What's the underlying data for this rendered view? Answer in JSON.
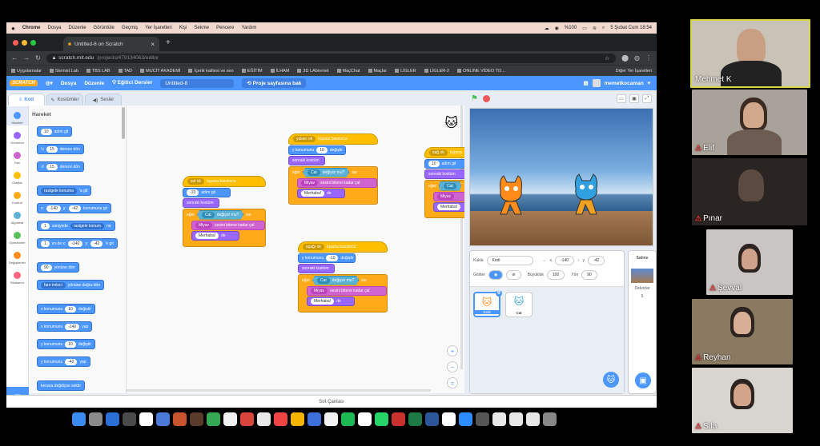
{
  "mac_menu": [
    "Chrome",
    "Dosya",
    "Düzenle",
    "Görüntüle",
    "Geçmiş",
    "Yer İşaretleri",
    "Kişi",
    "Sekme",
    "Pencere",
    "Yardım"
  ],
  "mac_status": {
    "battery": "%100",
    "date_time": "5 Şubat Cum  18:54"
  },
  "browser": {
    "tab_title": "Untitled-8 on Scratch",
    "url_host": "scratch.mit.edu",
    "url_path": "/projects/479134063/editor",
    "bookmarks": [
      "Uygulamalar",
      "Stemist Lab",
      "TBS LAB",
      "TAD",
      "MUCİT AKADEMİ",
      "İçerik kalitesi ve seo",
      "EĞİTİM",
      "İLHAM",
      "3D LAbirenet",
      "MaçChat",
      "Maçlar",
      "LİGLER",
      "LİGLER-2",
      "ONLINE VİDEO TO..."
    ],
    "other_bookmarks": "Diğer Yer İşaretleri"
  },
  "scratch_menu": {
    "logo": "SCRATCH",
    "file": "Dosya",
    "edit": "Düzenle",
    "tutorials": "Eğitici Dersler",
    "project_title": "Untitled-8",
    "share": "Proje sayfasına bak",
    "username": "memetkocaman"
  },
  "editor_tabs": {
    "code": "Kod",
    "costumes": "Kostümler",
    "sounds": "Sesler"
  },
  "categories": [
    "Hareket",
    "Görünüm",
    "Ses",
    "Olaylar",
    "Kontrol",
    "Algılama",
    "Operatörler",
    "Değişkenler",
    "Bloklarım"
  ],
  "palette": {
    "title": "Hareket",
    "move": "adım git",
    "move_val": "10",
    "turn_right": "derece dön",
    "turn_right_val": "15",
    "turn_left": "derece dön",
    "turn_left_val": "15",
    "goto": "rastgele konuma",
    "goto_suffix": "'a git",
    "goto_xy_x": "x:",
    "goto_xy_xv": "-140",
    "goto_xy_y": "y:",
    "goto_xy_yv": "-42",
    "goto_xy_suffix": "konumuna git",
    "glide": "saniyede",
    "glide_val": "1",
    "glide_dd": "rastgele konum",
    "glide_suffix": "na",
    "glide_xy": "sn.de x:",
    "glide_xy_val": "1",
    "glide_xy_x": "-140",
    "glide_xy_y": "y:",
    "glide_xy_yv": "-42",
    "glide_xy_suffix": "'e git",
    "point_dir": "yönüne dön",
    "point_dir_val": "90",
    "point_towards": "fare imleci",
    "point_towards_suffix": "yönüne doğru dön",
    "change_x": "x konumunu",
    "change_x_val": "10",
    "change_x_suffix": "değiştir",
    "set_x": "x konumunu",
    "set_x_val": "-140",
    "set_x_suffix": "yap",
    "change_y": "y konumunu",
    "change_y_val": "10",
    "change_y_suffix": "değiştir",
    "set_y": "y konumunu",
    "set_y_val": "-42",
    "set_y_suffix": "yap",
    "bounce": "kenara değdiyse sektir"
  },
  "scripts": {
    "left": {
      "key": "sol ok",
      "hat": "tuşuna basılınca",
      "move_val": "-10",
      "move": "adım git",
      "next": "sonraki kostüm",
      "if": "eğer",
      "sprite": "Cat",
      "touching": "değiyor mu?",
      "ise": "ise",
      "say": "Miyav",
      "sound": "sesini bitene kadar çal",
      "speak": "Merhaba!",
      "de": "de"
    },
    "up": {
      "key": "yukarı ok",
      "hat": "tuşuna basılınca",
      "ychange": "y konumunu",
      "ychange_val": "10",
      "ychange_suffix": "değiştir",
      "next": "sonraki kostüm",
      "if": "eğer",
      "sprite": "Cat",
      "touching": "değiyor mu?",
      "ise": "ise",
      "say": "Miyav",
      "sound": "sesini bitene kadar çal",
      "speak": "Merhaba!",
      "de": "de"
    },
    "down": {
      "key": "aşağı ok",
      "hat": "tuşuna basılınca",
      "ychange": "y konumunu",
      "ychange_val": "-10",
      "ychange_suffix": "değiştir",
      "next": "sonraki kostüm",
      "if": "eğer",
      "sprite": "Cat",
      "touching": "değiyor mu?",
      "ise": "ise",
      "say": "Miyav",
      "sound": "sesini bitene kadar çal",
      "speak": "Merhaba!",
      "de": "de"
    },
    "right": {
      "key": "sağ ok",
      "hat": "tuşuna",
      "move_val": "10",
      "move": "adım git",
      "next": "sonraki kostüm",
      "if": "eğer",
      "sprite": "Cat",
      "say": "Miyav",
      "speak": "Merhaba!"
    }
  },
  "sprite_info": {
    "label_sprite": "Kukla",
    "name": "Kedi",
    "x_label": "x",
    "x": "-140",
    "y_label": "y",
    "y": "-42",
    "show_label": "Göster",
    "size_label": "Büyüklük",
    "size": "100",
    "dir_label": "Yön",
    "dir": "90"
  },
  "sprites": [
    "Kedi",
    "Cat"
  ],
  "stage_pane": {
    "title": "Sahne",
    "backdrops_label": "Dekorlar",
    "backdrops_count": "5"
  },
  "backpack": "Sırt Çantası",
  "participants": [
    "Mehmet K",
    "Elif",
    "Pınar",
    "Şevval",
    "Reyhan",
    "Sıla"
  ],
  "colors": {
    "scratch_blue": "#4c97ff",
    "events": "#ffbf00",
    "control": "#ffab19",
    "looks": "#9966ff",
    "sensing": "#5cb1d6",
    "active_speaker": "#d8d84a"
  }
}
